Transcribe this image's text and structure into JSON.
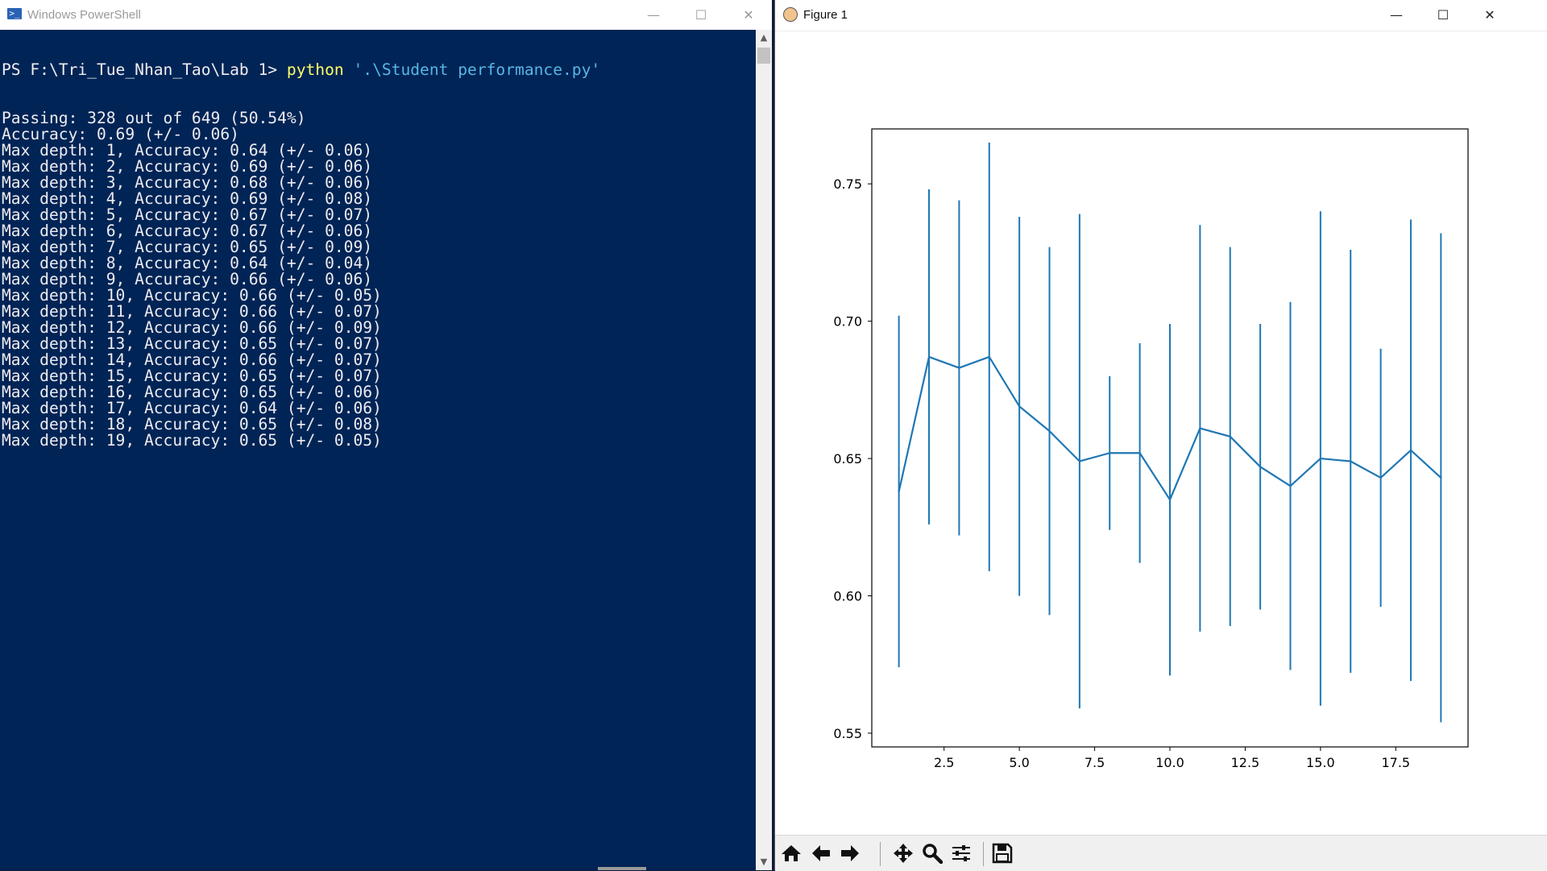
{
  "powershell": {
    "title": "Windows PowerShell",
    "icon": "powershell-icon",
    "controls": [
      "minimize",
      "maximize",
      "close"
    ],
    "prompt": "PS F:\\Tri_Tue_Nhan_Tao\\Lab 1>",
    "command": "python",
    "argument": "'.\\Student performance.py'",
    "output": [
      "Passing: 328 out of 649 (50.54%)",
      "Accuracy: 0.69 (+/- 0.06)",
      "Max depth: 1, Accuracy: 0.64 (+/- 0.06)",
      "Max depth: 2, Accuracy: 0.69 (+/- 0.06)",
      "Max depth: 3, Accuracy: 0.68 (+/- 0.06)",
      "Max depth: 4, Accuracy: 0.69 (+/- 0.08)",
      "Max depth: 5, Accuracy: 0.67 (+/- 0.07)",
      "Max depth: 6, Accuracy: 0.67 (+/- 0.06)",
      "Max depth: 7, Accuracy: 0.65 (+/- 0.09)",
      "Max depth: 8, Accuracy: 0.64 (+/- 0.04)",
      "Max depth: 9, Accuracy: 0.66 (+/- 0.06)",
      "Max depth: 10, Accuracy: 0.66 (+/- 0.05)",
      "Max depth: 11, Accuracy: 0.66 (+/- 0.07)",
      "Max depth: 12, Accuracy: 0.66 (+/- 0.09)",
      "Max depth: 13, Accuracy: 0.65 (+/- 0.07)",
      "Max depth: 14, Accuracy: 0.66 (+/- 0.07)",
      "Max depth: 15, Accuracy: 0.65 (+/- 0.07)",
      "Max depth: 16, Accuracy: 0.65 (+/- 0.06)",
      "Max depth: 17, Accuracy: 0.64 (+/- 0.06)",
      "Max depth: 18, Accuracy: 0.65 (+/- 0.08)",
      "Max depth: 19, Accuracy: 0.65 (+/- 0.05)"
    ],
    "colors": {
      "background": "#012456",
      "text": "#eeedf0",
      "command": "#ffff66",
      "string": "#56b6e6"
    }
  },
  "figure": {
    "title": "Figure 1",
    "controls": [
      "minimize",
      "maximize",
      "close"
    ],
    "toolbar": [
      {
        "name": "home-icon",
        "label": "Home"
      },
      {
        "name": "arrow-left-icon",
        "label": "Back"
      },
      {
        "name": "arrow-right-icon",
        "label": "Forward"
      },
      {
        "name": "move-icon",
        "label": "Pan"
      },
      {
        "name": "zoom-icon",
        "label": "Zoom"
      },
      {
        "name": "sliders-icon",
        "label": "Configure subplots"
      },
      {
        "name": "save-icon",
        "label": "Save"
      }
    ]
  },
  "chart_data": {
    "type": "line",
    "title": "",
    "xlabel": "",
    "ylabel": "",
    "error_bars": true,
    "grid": false,
    "xlim": [
      0.1,
      19.9
    ],
    "ylim": [
      0.545,
      0.77
    ],
    "xticks": [
      2.5,
      5.0,
      7.5,
      10.0,
      12.5,
      15.0,
      17.5
    ],
    "xtick_labels": [
      "2.5",
      "5.0",
      "7.5",
      "10.0",
      "12.5",
      "15.0",
      "17.5"
    ],
    "yticks": [
      0.55,
      0.6,
      0.65,
      0.7,
      0.75
    ],
    "ytick_labels": [
      "0.55",
      "0.60",
      "0.65",
      "0.70",
      "0.75"
    ],
    "color": "#1f77b4",
    "x": [
      1,
      2,
      3,
      4,
      5,
      6,
      7,
      8,
      9,
      10,
      11,
      12,
      13,
      14,
      15,
      16,
      17,
      18,
      19
    ],
    "y": [
      0.638,
      0.687,
      0.683,
      0.687,
      0.669,
      0.66,
      0.649,
      0.652,
      0.652,
      0.635,
      0.661,
      0.658,
      0.647,
      0.64,
      0.65,
      0.649,
      0.643,
      0.653,
      0.643
    ],
    "yerr": [
      0.064,
      0.061,
      0.061,
      0.078,
      0.069,
      0.067,
      0.09,
      0.028,
      0.04,
      0.064,
      0.074,
      0.069,
      0.052,
      0.067,
      0.09,
      0.077,
      0.047,
      0.084,
      0.089
    ]
  }
}
